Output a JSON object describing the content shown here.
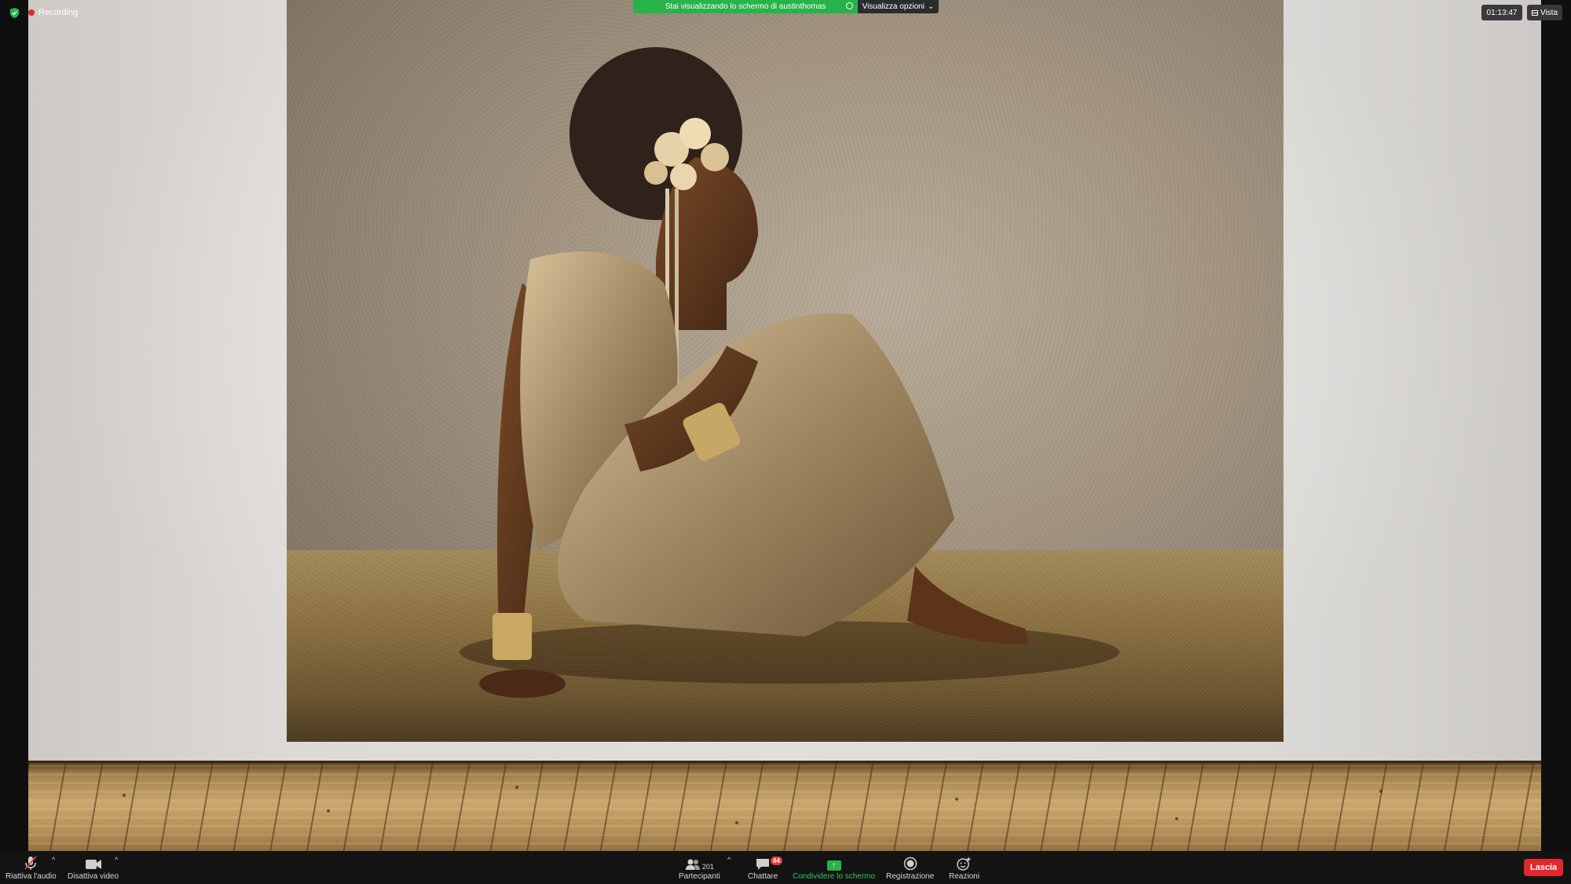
{
  "top_bar": {
    "recording_label": "Recording",
    "share_banner": "Stai visualizzando lo schermo di austinthomas",
    "view_options": "Visualizza opzioni",
    "timer": "01:13:47",
    "view_button": "Vista"
  },
  "toolbar": {
    "audio_label": "Riattiva l'audio",
    "video_label": "Disattiva video",
    "participants_label": "Partecipanti",
    "participants_count": "201",
    "chat_label": "Chattare",
    "chat_badge": "64",
    "share_label": "Condividere lo schermo",
    "record_label": "Registrazione",
    "reactions_label": "Reazioni",
    "leave_label": "Lascia"
  },
  "colors": {
    "share_green": "#27b34a",
    "leave_red": "#e0282e",
    "recording_red": "#e0242d"
  }
}
